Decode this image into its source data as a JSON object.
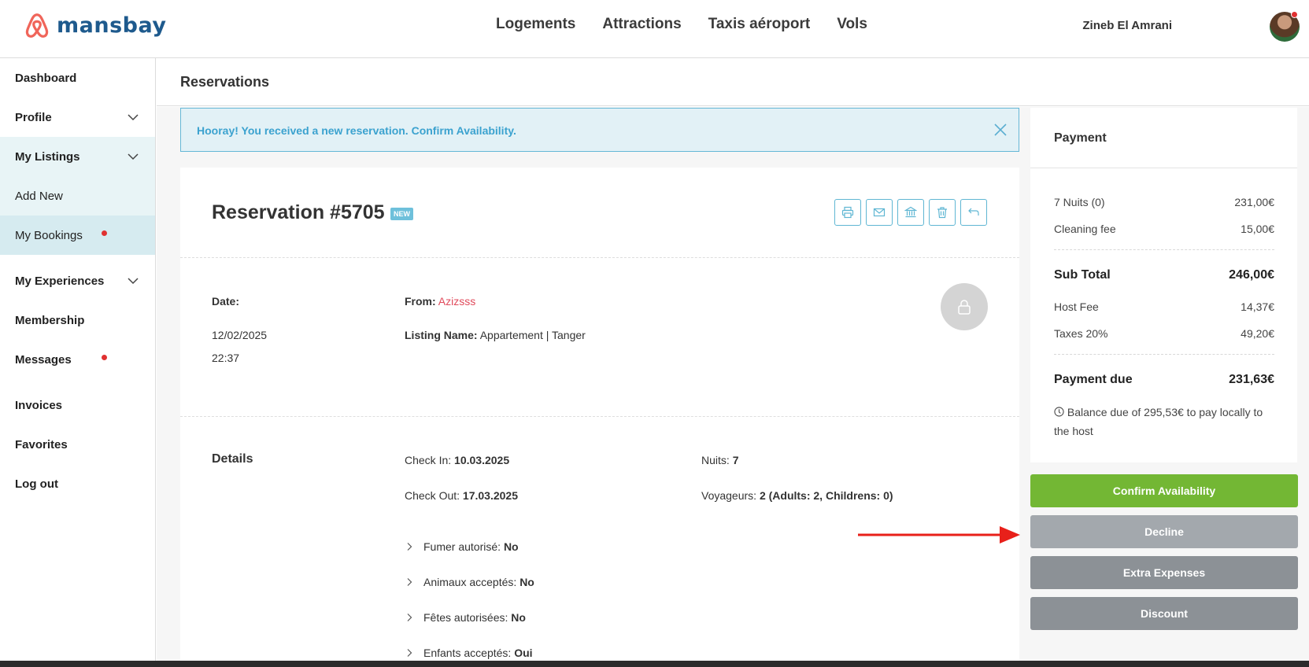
{
  "brand": {
    "name": "mansbay",
    "color": "#1e5a8d",
    "logo_color": "#f0655a"
  },
  "topnav": [
    "Logements",
    "Attractions",
    "Taxis aéroport",
    "Vols"
  ],
  "user": {
    "name": "Zineb El Amrani"
  },
  "sidebar": {
    "items": [
      {
        "label": "Dashboard"
      },
      {
        "label": "Profile"
      },
      {
        "label": "My Listings"
      },
      {
        "label": "Add New"
      },
      {
        "label": "My Bookings"
      },
      {
        "label": "My Experiences"
      },
      {
        "label": "Membership"
      },
      {
        "label": "Messages"
      },
      {
        "label": "Invoices"
      },
      {
        "label": "Favorites"
      },
      {
        "label": "Log out"
      }
    ]
  },
  "page": {
    "title": "Reservations"
  },
  "alert": {
    "text": "Hooray! You received a new reservation. Confirm Availability."
  },
  "reservation": {
    "title": "Reservation #5705",
    "badge": "NEW",
    "date_label": "Date:",
    "date": "12/02/2025",
    "time": "22:37",
    "from_label": "From:",
    "from_name": "Azizsss",
    "listing_label": "Listing Name:",
    "listing_name": "Appartement | Tanger"
  },
  "details": {
    "title": "Details",
    "checkin_label": "Check In:",
    "checkin": "10.03.2025",
    "checkout_label": "Check Out:",
    "checkout": "17.03.2025",
    "nights_label": "Nuits:",
    "nights": "7",
    "travelers_label": "Voyageurs:",
    "travelers": "2 (Adults: 2, Childrens: 0)",
    "rules": [
      {
        "label": "Fumer autorisé:",
        "value": "No"
      },
      {
        "label": "Animaux acceptés:",
        "value": "No"
      },
      {
        "label": "Fêtes autorisées:",
        "value": "No"
      },
      {
        "label": "Enfants acceptés:",
        "value": "Oui"
      }
    ]
  },
  "payment": {
    "title": "Payment",
    "nights_label": "7 Nuits (0)",
    "nights_value": "231,00€",
    "cleaning_label": "Cleaning fee",
    "cleaning_value": "15,00€",
    "subtotal_label": "Sub Total",
    "subtotal_value": "246,00€",
    "hostfee_label": "Host Fee",
    "hostfee_value": "14,37€",
    "taxes_label": "Taxes 20%",
    "taxes_value": "49,20€",
    "due_label": "Payment due",
    "due_value": "231,63€",
    "note": "Balance due of 295,53€ to pay locally to the host"
  },
  "buttons": {
    "confirm": "Confirm Availability",
    "decline": "Decline",
    "extra": "Extra Expenses",
    "discount": "Discount"
  },
  "colors": {
    "confirm": "#73b734",
    "decline": "#a3a8ad",
    "secondary": "#8c9196",
    "accent": "#3ba2cf",
    "annotation_arrow": "#e8201a"
  },
  "icons": [
    "print-icon",
    "mail-icon",
    "bank-icon",
    "trash-icon",
    "reply-icon",
    "close-icon",
    "chevron-down-icon",
    "chevron-right-icon",
    "user-icon",
    "info-icon"
  ]
}
